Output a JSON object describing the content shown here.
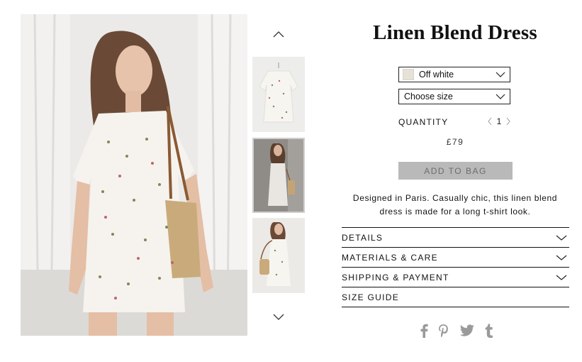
{
  "product": {
    "title": "Linen Blend Dress",
    "price": "£79",
    "description_line1": "Designed in Paris. Casually chic, this linen blend",
    "description_line2": "dress is made for a long t-shirt look."
  },
  "color_select": {
    "value": "Off white",
    "swatch_color": "#e7e2d8"
  },
  "size_select": {
    "value": "Choose size"
  },
  "quantity": {
    "label": "QUANTITY",
    "value": "1"
  },
  "add_to_bag": {
    "label": "ADD TO BAG"
  },
  "accordion": [
    {
      "label": "DETAILS",
      "expandable": true
    },
    {
      "label": "MATERIALS & CARE",
      "expandable": true
    },
    {
      "label": "SHIPPING & PAYMENT",
      "expandable": true
    },
    {
      "label": "SIZE GUIDE",
      "expandable": false
    }
  ],
  "gallery": {
    "thumbnails": [
      {
        "name": "dress-flat-view"
      },
      {
        "name": "model-front-view",
        "selected": true
      },
      {
        "name": "model-side-view"
      }
    ]
  },
  "social": [
    {
      "name": "facebook-icon",
      "glyph": "f"
    },
    {
      "name": "pinterest-icon",
      "glyph": "P"
    },
    {
      "name": "twitter-icon"
    },
    {
      "name": "tumblr-icon",
      "glyph": "t"
    }
  ],
  "colors": {
    "button_bg": "#b9b9b9",
    "button_text": "#6c6c6c",
    "icon_gray": "#9a9a9a"
  }
}
